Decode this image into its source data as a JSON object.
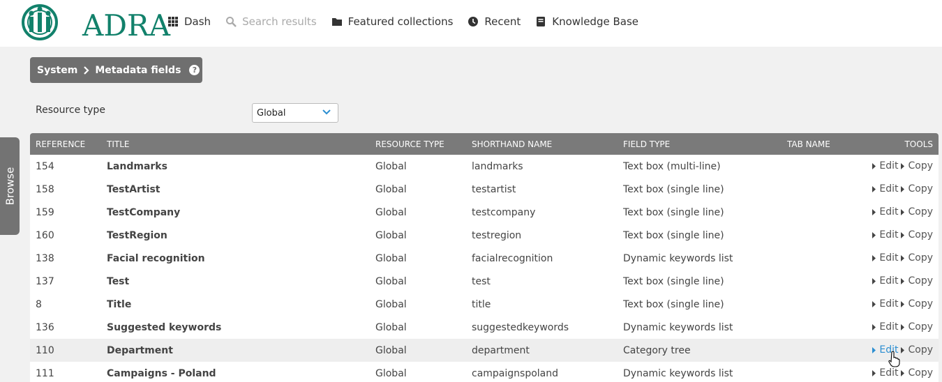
{
  "header": {
    "logo_text": "ADRA",
    "brand_color": "#12816b",
    "nav": [
      {
        "label": "Dash",
        "icon": "grid-icon",
        "disabled": false
      },
      {
        "label": "Search results",
        "icon": "search-icon",
        "disabled": true
      },
      {
        "label": "Featured collections",
        "icon": "folder-icon",
        "disabled": false
      },
      {
        "label": "Recent",
        "icon": "clock-icon",
        "disabled": false
      },
      {
        "label": "Knowledge Base",
        "icon": "book-icon",
        "disabled": false
      }
    ]
  },
  "breadcrumb": {
    "parent": "System",
    "current": "Metadata fields"
  },
  "resource_type": {
    "label": "Resource type",
    "selected": "Global"
  },
  "browse_tab": {
    "label": "Browse"
  },
  "table": {
    "columns": [
      "REFERENCE",
      "TITLE",
      "RESOURCE TYPE",
      "SHORTHAND NAME",
      "FIELD TYPE",
      "TAB NAME",
      "TOOLS"
    ],
    "tools": {
      "edit": "Edit",
      "copy": "Copy"
    },
    "rows": [
      {
        "ref": "154",
        "title": "Landmarks",
        "type": "Global",
        "short": "landmarks",
        "field": "Text box (multi-line)",
        "tab": ""
      },
      {
        "ref": "158",
        "title": "TestArtist",
        "type": "Global",
        "short": "testartist",
        "field": "Text box (single line)",
        "tab": ""
      },
      {
        "ref": "159",
        "title": "TestCompany",
        "type": "Global",
        "short": "testcompany",
        "field": "Text box (single line)",
        "tab": ""
      },
      {
        "ref": "160",
        "title": "TestRegion",
        "type": "Global",
        "short": "testregion",
        "field": "Text box (single line)",
        "tab": ""
      },
      {
        "ref": "138",
        "title": "Facial recognition",
        "type": "Global",
        "short": "facialrecognition",
        "field": "Dynamic keywords list",
        "tab": ""
      },
      {
        "ref": "137",
        "title": "Test",
        "type": "Global",
        "short": "test",
        "field": "Text box (single line)",
        "tab": ""
      },
      {
        "ref": "8",
        "title": "Title",
        "type": "Global",
        "short": "title",
        "field": "Text box (single line)",
        "tab": ""
      },
      {
        "ref": "136",
        "title": "Suggested keywords",
        "type": "Global",
        "short": "suggestedkeywords",
        "field": "Dynamic keywords list",
        "tab": ""
      },
      {
        "ref": "110",
        "title": "Department",
        "type": "Global",
        "short": "department",
        "field": "Category tree",
        "tab": "",
        "hover": true
      },
      {
        "ref": "111",
        "title": "Campaigns - Poland",
        "type": "Global",
        "short": "campaignspoland",
        "field": "Dynamic keywords list",
        "tab": ""
      }
    ]
  },
  "colors": {
    "link_active": "#2b8ed1",
    "header_row": "#7a7a7a",
    "breadcrumb": "#6f6f6f"
  }
}
